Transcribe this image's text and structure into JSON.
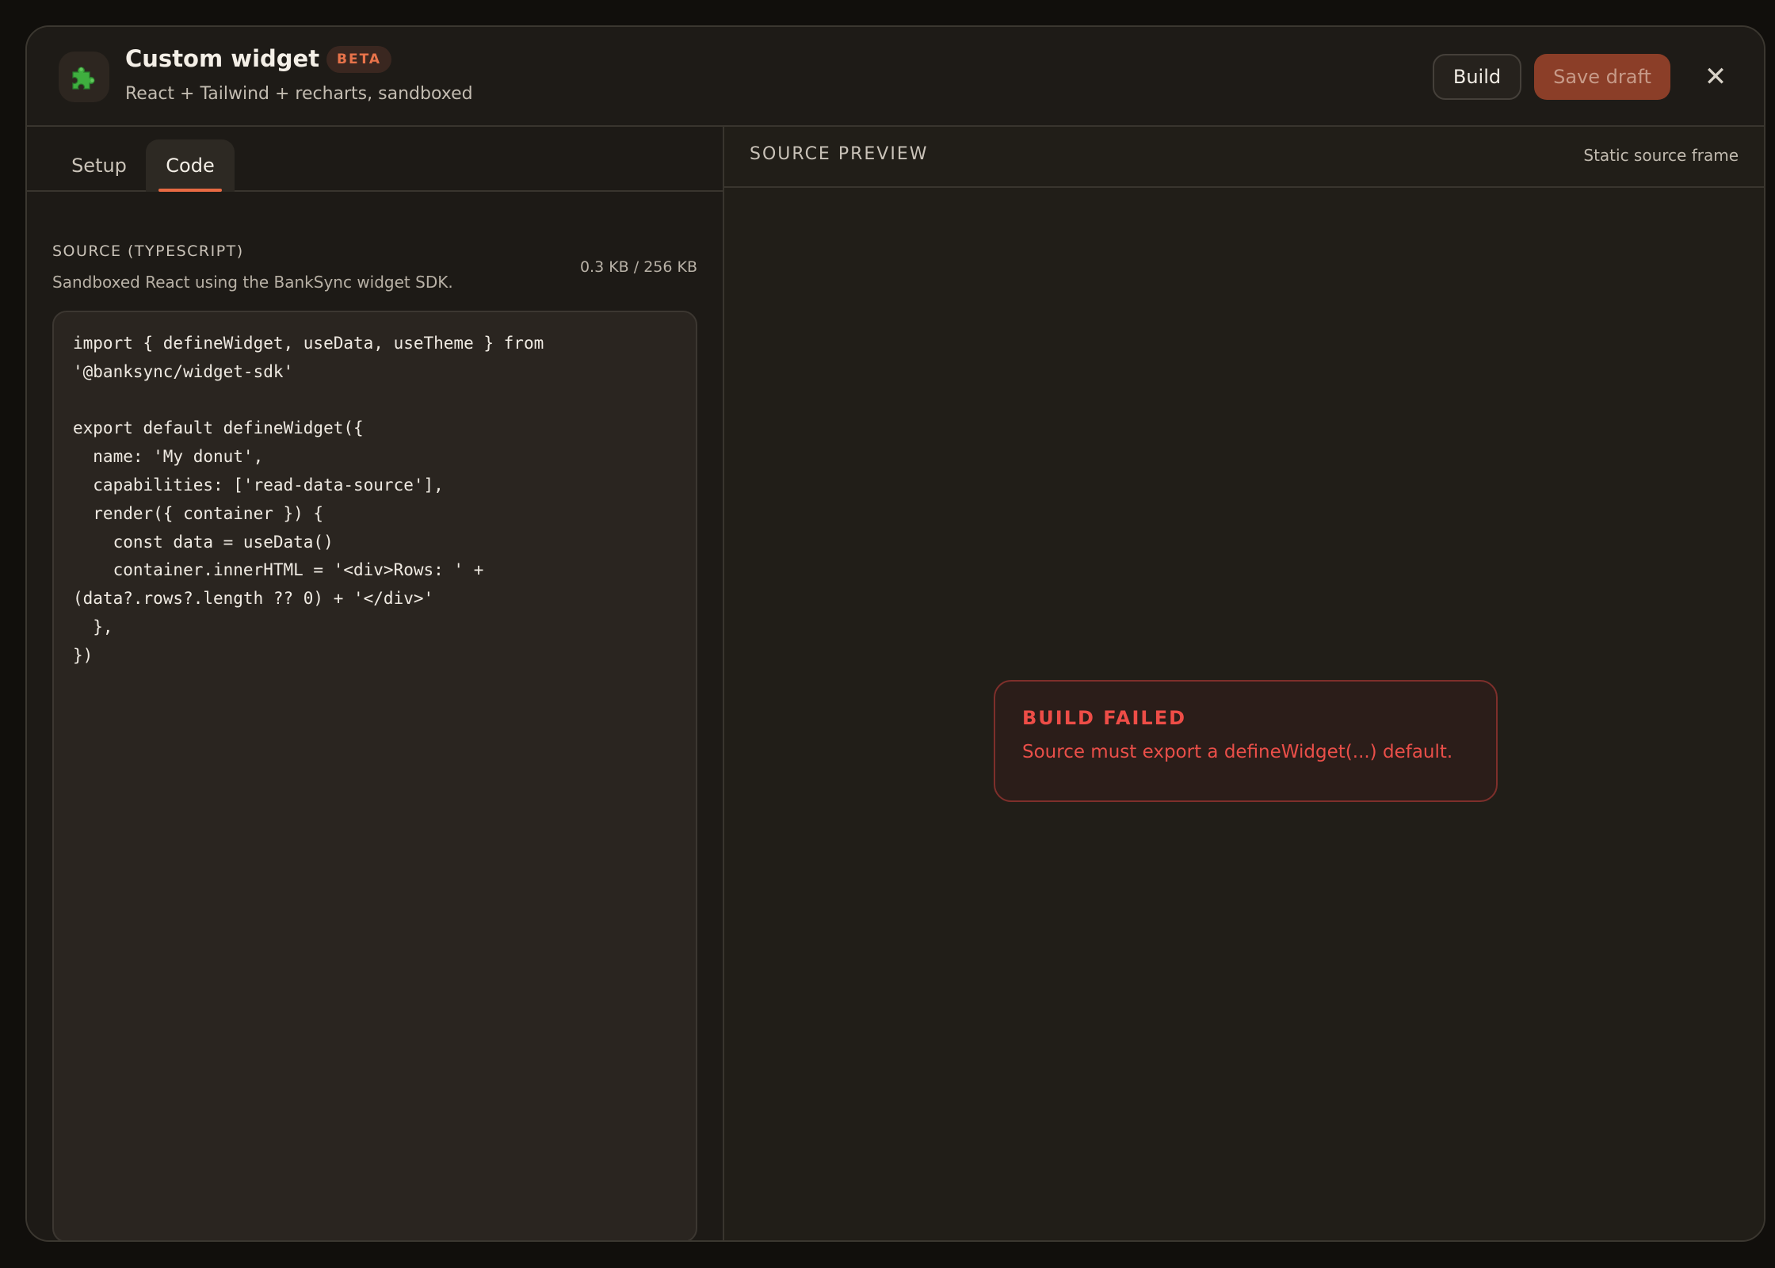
{
  "header": {
    "icon": "puzzle-piece-icon",
    "title": "Custom widget",
    "badge": "BETA",
    "subtitle": "React + Tailwind + recharts, sandboxed",
    "build_label": "Build",
    "save_draft_label": "Save draft",
    "close_glyph": "✕"
  },
  "tabs": [
    {
      "label": "Setup",
      "active": false
    },
    {
      "label": "Code",
      "active": true
    }
  ],
  "source": {
    "label": "SOURCE (TYPESCRIPT)",
    "description": "Sandboxed React using the BankSync widget SDK.",
    "size": "0.3 KB / 256 KB",
    "code": "import { defineWidget, useData, useTheme } from\n'@banksync/widget-sdk'\n\nexport default defineWidget({\n  name: 'My donut',\n  capabilities: ['read-data-source'],\n  render({ container }) {\n    const data = useData()\n    container.innerHTML = '<div>Rows: ' +\n(data?.rows?.length ?? 0) + '</div>'\n  },\n})"
  },
  "preview": {
    "title": "SOURCE PREVIEW",
    "frame_label": "Static source frame",
    "error": {
      "title": "BUILD FAILED",
      "message": "Source must export a defineWidget(...) default."
    }
  },
  "colors": {
    "accent": "#e86a43",
    "save_button_bg": "#8b3e28",
    "error_text": "#ee4d47",
    "error_border": "#7e2f2b",
    "background": "#1d1a16"
  }
}
